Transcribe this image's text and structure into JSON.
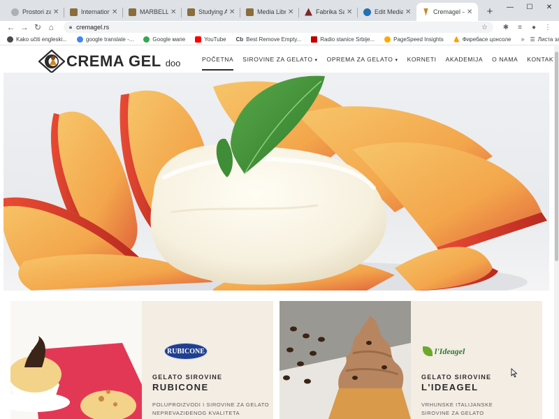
{
  "browser": {
    "tabs": [
      {
        "title": "Prostori za vem",
        "color": "#b0b0b0"
      },
      {
        "title": "International U",
        "color": "#8a6d3b"
      },
      {
        "title": "MARBELLA inte",
        "color": "#8a6d3b"
      },
      {
        "title": "Studying Abroa",
        "color": "#8a6d3b"
      },
      {
        "title": "Media Library",
        "color": "#8a6d3b"
      },
      {
        "title": "Fabrika Sajtova",
        "color": "#7a2a2a"
      },
      {
        "title": "Edit Media ‹ Fa",
        "color": "#2271b1"
      },
      {
        "title": "Cremagel – Poc",
        "color": "#c98a2c",
        "active": true
      }
    ],
    "new_tab": "+",
    "window_controls": [
      "—",
      "☐",
      "✕"
    ],
    "url": "cremagel.rs",
    "bookmarks": [
      {
        "label": "Kako učiti engleski...",
        "color": "#4a4a4a"
      },
      {
        "label": "google translate -...",
        "color": "#4285f4"
      },
      {
        "label": "Google мапе",
        "color": "#34a853"
      },
      {
        "label": "YouTube",
        "color": "#ff0000"
      },
      {
        "label": "Best Remove Empty...",
        "color": "#333333",
        "prefix": "Cb"
      },
      {
        "label": "Radio stanice Srbije...",
        "color": "#c00000"
      },
      {
        "label": "PageSpeed Insights",
        "color": "#f9ab00"
      },
      {
        "label": "Фиребасе цонсоле",
        "color": "#ffa000"
      }
    ],
    "bookmarks_more": "»",
    "reading_list": "Листа за читање"
  },
  "site": {
    "brand": "CREMA GEL",
    "brand_suffix": "doo",
    "nav": [
      {
        "label": "POČETNA",
        "active": true
      },
      {
        "label": "SIROVINE ZA GELATO",
        "dropdown": true
      },
      {
        "label": "OPREMA ZA GELATO",
        "dropdown": true
      },
      {
        "label": "KORNETI"
      },
      {
        "label": "AKADEMIJA"
      },
      {
        "label": "O NAMA"
      },
      {
        "label": "KONTAKT"
      }
    ],
    "cards": [
      {
        "logo_text": "RUBICONE",
        "eyebrow": "GELATO SIROVINE",
        "title": "RUBICONE",
        "desc": "POLUPROIZVODI I SIROVINE ZA GELATO NEPREVAZIĐENOG KVALITETA"
      },
      {
        "logo_text": "l'Ideagel",
        "eyebrow": "GELATO SIROVINE",
        "title": "L'IDEAGEL",
        "desc": "VRHUNSKE ITALIJANSKE SIROVINE ZA GELATO"
      }
    ]
  }
}
